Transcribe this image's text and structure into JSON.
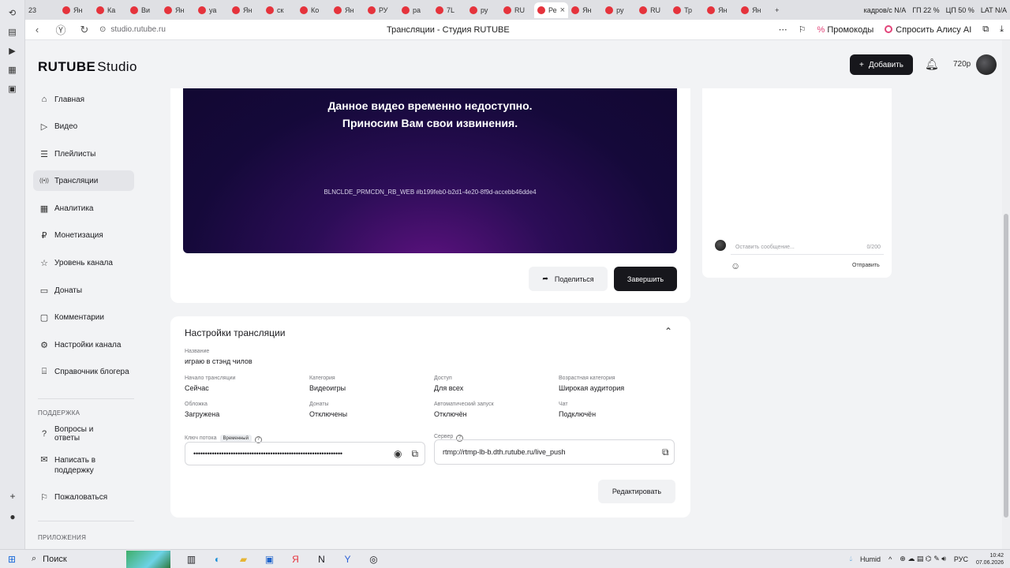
{
  "browser": {
    "tabs": [
      "Ян",
      "Ка",
      "Ви",
      "Ян",
      "уа",
      "Ян",
      "ск",
      "Ко",
      "Ян",
      "РУ",
      "ра",
      "7L",
      "ру",
      "RU",
      "Ре",
      "Ян",
      "ру",
      "RU",
      "Тр",
      "Ян",
      "Ян"
    ],
    "active_tab_index": 14,
    "url": "studio.rutube.ru",
    "page_title": "Трансляции - Студия RUTUBE",
    "promo_label": "Промокоды",
    "alice_label": "Спросить Алису AI",
    "sys_stats": [
      "кадров/с N/A",
      "ГП 22 %",
      "ЦП 50 %",
      "LAT N/A"
    ],
    "tab_badge": "23"
  },
  "header": {
    "logo_main": "RUTUBE",
    "logo_sub": "Studio",
    "add_label": "Добавить",
    "quality": "720p"
  },
  "sidebar": {
    "items": [
      {
        "label": "Главная",
        "icon": "home-icon"
      },
      {
        "label": "Видео",
        "icon": "play-icon"
      },
      {
        "label": "Плейлисты",
        "icon": "playlist-icon"
      },
      {
        "label": "Трансляции",
        "icon": "broadcast-icon"
      },
      {
        "label": "Аналитика",
        "icon": "chart-icon"
      },
      {
        "label": "Монетизация",
        "icon": "coin-icon"
      },
      {
        "label": "Уровень канала",
        "icon": "star-icon"
      },
      {
        "label": "Донаты",
        "icon": "donate-icon"
      },
      {
        "label": "Комментарии",
        "icon": "comment-icon"
      },
      {
        "label": "Настройки канала",
        "icon": "settings-icon"
      },
      {
        "label": "Справочник блогера",
        "icon": "book-icon"
      }
    ],
    "support_label": "ПОДДЕРЖКА",
    "support_items": [
      {
        "label": "Вопросы и ответы",
        "icon": "question-icon"
      },
      {
        "label": "Написать в поддержку",
        "icon": "mail-icon"
      },
      {
        "label": "Пожаловаться",
        "icon": "flag-icon"
      }
    ],
    "apps_label": "ПРИЛОЖЕНИЯ"
  },
  "player": {
    "message_line1": "Данное видео временно недоступно.",
    "message_line2": "Приносим Вам свои извинения.",
    "error_code": "BLNCLDE_PRMCDN_RB_WEB #b199feb0-b2d1-4e20-8f9d-accebb46dde4",
    "share_label": "Поделиться",
    "end_label": "Завершить"
  },
  "settings": {
    "title": "Настройки трансляции",
    "name_label": "Название",
    "name_value": "играю в стэнд чилов",
    "start_label": "Начало трансляции",
    "start_value": "Сейчас",
    "category_label": "Категория",
    "category_value": "Видеоигры",
    "access_label": "Доступ",
    "access_value": "Для всех",
    "age_label": "Возрастная категория",
    "age_value": "Широкая аудитория",
    "cover_label": "Обложка",
    "cover_value": "Загружена",
    "donates_label": "Донаты",
    "donates_value": "Отключены",
    "autostart_label": "Автоматический запуск",
    "autostart_value": "Отключён",
    "chat_label": "Чат",
    "chat_value": "Подключён",
    "key_label": "Ключ потока",
    "key_badge": "Временный",
    "key_value": "••••••••••••••••••••••••••••••••••••••••••••••••••••••••••••••••",
    "server_label": "Сервер",
    "server_value": "rtmp://rtmp-lb-b.dth.rutube.ru/live_push",
    "edit_label": "Редактировать"
  },
  "chat": {
    "placeholder": "Оставить сообщение...",
    "counter": "0/200",
    "send_label": "Отправить"
  },
  "taskbar": {
    "search_label": "Поиск",
    "weather": "Humid",
    "lang": "РУС",
    "time": "10:42",
    "date": "07.06.2026"
  }
}
